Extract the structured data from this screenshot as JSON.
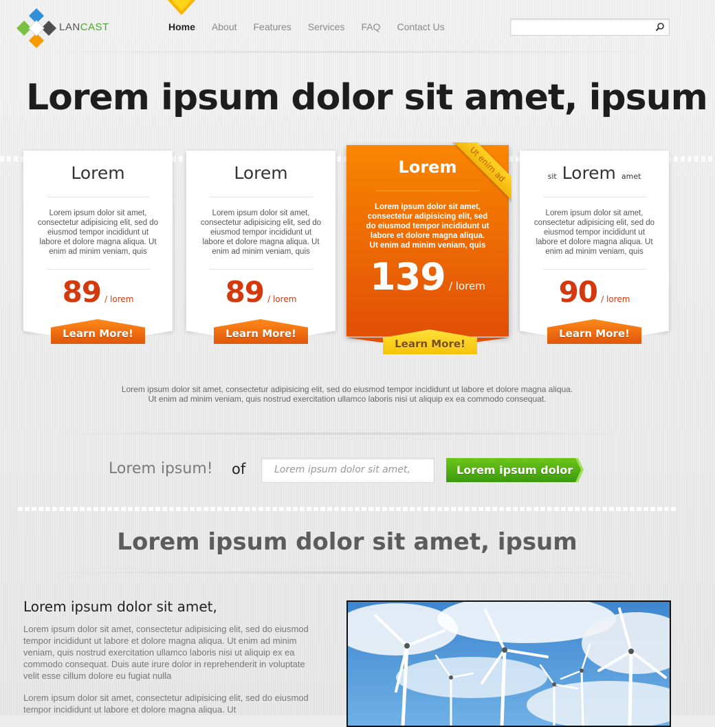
{
  "brand": {
    "name_part1": "LAN",
    "name_part2": "CAST",
    "accent": "#4aa32a"
  },
  "nav": {
    "items": [
      {
        "label": "Home",
        "active": true
      },
      {
        "label": "About"
      },
      {
        "label": "Features"
      },
      {
        "label": "Services"
      },
      {
        "label": "FAQ"
      },
      {
        "label": "Contact Us"
      }
    ]
  },
  "search": {
    "placeholder": "",
    "icon": "search-icon"
  },
  "hero": {
    "title": "Lorem ipsum dolor sit amet, ipsum"
  },
  "pricing": {
    "cards": [
      {
        "title": "Lorem",
        "text": "Lorem ipsum dolor sit amet, consectetur adipisicing elit, sed do eiusmod tempor incididunt ut labore et dolore magna aliqua. Ut enim ad minim veniam, quis",
        "price": "89",
        "unit": "/ lorem",
        "button": "Learn More!"
      },
      {
        "title": "Lorem",
        "text": "Lorem ipsum dolor sit amet, consectetur adipisicing elit, sed do eiusmod tempor incididunt ut labore et dolore magna aliqua. Ut enim ad minim veniam, quis",
        "price": "89",
        "unit": "/ lorem",
        "button": "Learn More!"
      },
      {
        "title": "Lorem",
        "ribbon": "Ut enim ad",
        "text": "Lorem ipsum dolor sit amet, consectetur adipisicing elit, sed do eiusmod tempor incididunt ut labore et dolore magna aliqua. Ut enim ad minim veniam, quis",
        "price": "139",
        "unit": "/ lorem",
        "button": "Learn More!"
      },
      {
        "title_prefix": "sit",
        "title": "Lorem",
        "title_suffix": "amet",
        "text": "Lorem ipsum dolor sit amet, consectetur adipisicing elit, sed do eiusmod tempor incididunt ut labore et dolore magna aliqua. Ut enim ad minim veniam, quis",
        "price": "90",
        "unit": "/ lorem",
        "button": "Learn More!"
      }
    ],
    "note_line1": "Lorem ipsum dolor sit amet, consectetur adipisicing elit, sed do eiusmod tempor incididunt ut labore et dolore magna aliqua.",
    "note_line2": "Ut enim ad minim veniam, quis nostrud exercitation ullamco laboris nisi ut aliquip ex ea commodo consequat."
  },
  "cta": {
    "label": "Lorem ipsum!",
    "of": "of",
    "placeholder": "Lorem ipsum dolor sit amet,",
    "button": "Lorem ipsum dolor"
  },
  "section": {
    "title": "Lorem ipsum dolor sit amet, ipsum",
    "subtitle": "Lorem ipsum dolor sit amet,",
    "para1": "Lorem ipsum dolor sit amet, consectetur adipisicing elit, sed do eiusmod tempor incididunt ut labore et dolore magna aliqua. Ut enim ad minim veniam, quis nostrud exercitation ullamco laboris nisi ut aliquip ex ea commodo consequat. Duis aute irure dolor in reprehenderit in voluptate velit esse cillum dolore eu fugiat nulla",
    "para2": "Lorem ipsum dolor sit amet, consectetur adipisicing elit, sed do eiusmod tempor incididunt ut labore et dolore magna aliqua. Ut",
    "image": "wind-turbines-photo"
  }
}
